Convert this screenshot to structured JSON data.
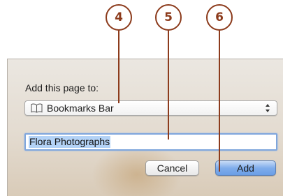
{
  "callouts": [
    "4",
    "5",
    "6"
  ],
  "dialog": {
    "prompt_label": "Add this page to:",
    "location_select": {
      "selected_value": "Bookmarks Bar",
      "icon": "book-icon"
    },
    "title_field": {
      "value": "Flora Photographs"
    },
    "buttons": {
      "cancel_label": "Cancel",
      "add_label": "Add"
    }
  },
  "colors": {
    "callout": "#8c3b1c",
    "default_button": "#6a9ee6",
    "text_selection": "#b3d2f6",
    "focus_ring": "#7fa6dc"
  }
}
